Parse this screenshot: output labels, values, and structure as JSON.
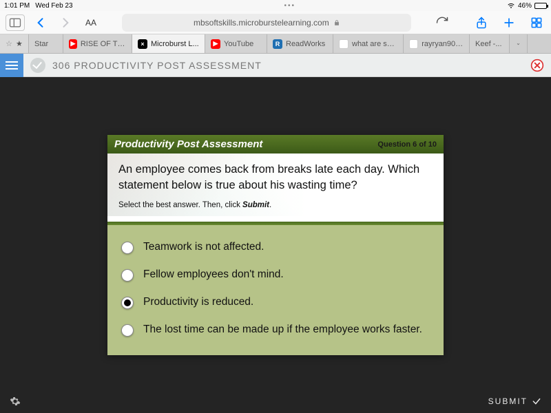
{
  "status": {
    "time": "1:01 PM",
    "date": "Wed Feb 23",
    "battery": "46%"
  },
  "browser": {
    "url_display": "mbsoftskills.microburstelearning.com",
    "aa_label": "AA",
    "tabs": [
      {
        "label": "Star",
        "icon": "star"
      },
      {
        "label": "RISE OF THE...",
        "icon": "yt"
      },
      {
        "label": "Microburst L...",
        "icon": "mb",
        "active": true
      },
      {
        "label": "YouTube",
        "icon": "yt"
      },
      {
        "label": "ReadWorks",
        "icon": "rw"
      },
      {
        "label": "what are so...",
        "icon": "gg"
      },
      {
        "label": "rayryan90 -...",
        "icon": "gg"
      },
      {
        "label": "Keef -...",
        "icon": "none"
      }
    ]
  },
  "course": {
    "title": "306 PRODUCTIVITY POST ASSESSMENT"
  },
  "quiz": {
    "title": "Productivity Post Assessment",
    "progress": "Question 6 of 10",
    "question": "An employee comes back from breaks late each day. Which statement below is true about his wasting time?",
    "instruction_a": "Select the best answer. Then, click ",
    "instruction_b": "Submit",
    "instruction_c": ".",
    "answers": [
      {
        "text": "Teamwork is not affected.",
        "selected": false
      },
      {
        "text": "Fellow employees don't mind.",
        "selected": false
      },
      {
        "text": "Productivity is reduced.",
        "selected": true
      },
      {
        "text": "The lost time can be made up if the employee works faster.",
        "selected": false
      }
    ],
    "submit_label": "SUBMIT"
  }
}
